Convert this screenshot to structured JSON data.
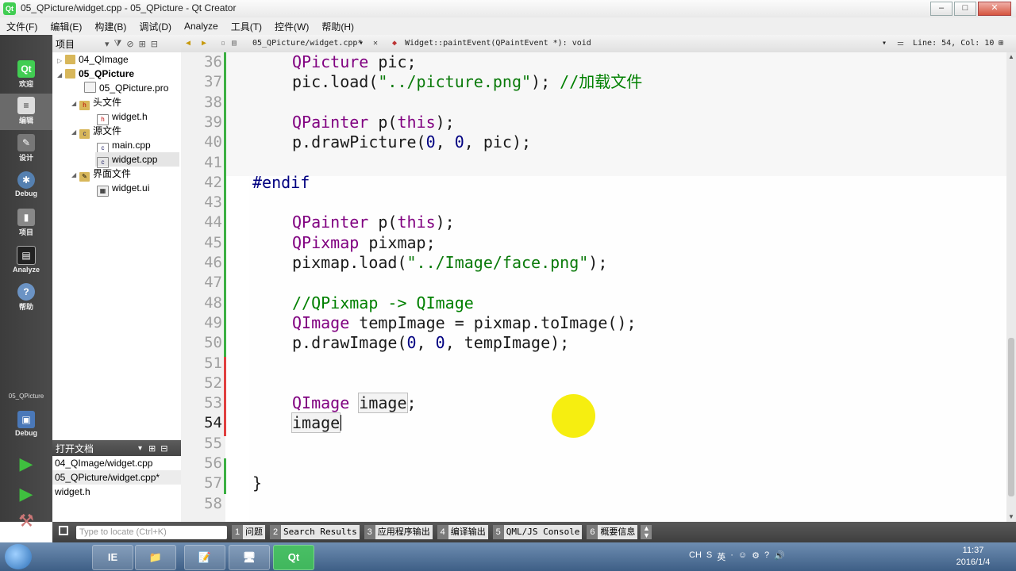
{
  "window": {
    "title": "05_QPicture/widget.cpp - 05_QPicture - Qt Creator",
    "app_icon": "Qt",
    "buttons": [
      "–",
      "□",
      "✕"
    ]
  },
  "menu": [
    "文件(F)",
    "编辑(E)",
    "构建(B)",
    "调试(D)",
    "Analyze",
    "工具(T)",
    "控件(W)",
    "帮助(H)"
  ],
  "modes": [
    {
      "label": "欢迎",
      "icon": "qt-logo-icon"
    },
    {
      "label": "编辑",
      "icon": "edit-document-icon"
    },
    {
      "label": "设计",
      "icon": "design-pen-icon"
    },
    {
      "label": "Debug",
      "icon": "debug-bug-icon"
    },
    {
      "label": "项目",
      "icon": "project-wrench-icon"
    },
    {
      "label": "Analyze",
      "icon": "analyze-icon"
    },
    {
      "label": "帮助",
      "icon": "help-icon"
    }
  ],
  "mode_project": "05_QPicture",
  "mode_debug": "Debug",
  "project_panel": {
    "title": "项目",
    "tree": [
      {
        "label": "04_QImage",
        "indent": 0,
        "arrow": "▷",
        "icon": "folder-icon",
        "bold": false
      },
      {
        "label": "05_QPicture",
        "indent": 0,
        "arrow": "◢",
        "icon": "folder-icon",
        "bold": true
      },
      {
        "label": "05_QPicture.pro",
        "indent": 1,
        "arrow": "",
        "icon": "pro-file-icon",
        "bold": false
      },
      {
        "label": "头文件",
        "indent": 1,
        "arrow": "◢",
        "icon": "header-folder-icon",
        "bold": false
      },
      {
        "label": "widget.h",
        "indent": 2,
        "arrow": "",
        "icon": "h-file-icon",
        "bold": false
      },
      {
        "label": "源文件",
        "indent": 1,
        "arrow": "◢",
        "icon": "source-folder-icon",
        "bold": false
      },
      {
        "label": "main.cpp",
        "indent": 2,
        "arrow": "",
        "icon": "cpp-file-icon",
        "bold": false
      },
      {
        "label": "widget.cpp",
        "indent": 2,
        "arrow": "",
        "icon": "cpp-file-icon",
        "bold": false,
        "selected": true
      },
      {
        "label": "界面文件",
        "indent": 1,
        "arrow": "◢",
        "icon": "forms-folder-icon",
        "bold": false
      },
      {
        "label": "widget.ui",
        "indent": 2,
        "arrow": "",
        "icon": "ui-file-icon",
        "bold": false
      }
    ]
  },
  "open_docs": {
    "title": "打开文档",
    "items": [
      "04_QImage/widget.cpp",
      "05_QPicture/widget.cpp*",
      "widget.h"
    ]
  },
  "editor_toolbar": {
    "file": "05_QPicture/widget.cpp*",
    "function": "Widget::paintEvent(QPaintEvent *): void",
    "position": "Line: 54, Col: 10"
  },
  "code": [
    {
      "n": "36",
      "html_parts": [
        {
          "c": "t",
          "v": "QPicture"
        },
        {
          "c": "",
          "v": " pic;"
        }
      ]
    },
    {
      "n": "37",
      "html_parts": [
        {
          "c": "",
          "v": "pic.load("
        },
        {
          "c": "s",
          "v": "\"../picture.png\""
        },
        {
          "c": "",
          "v": "); "
        },
        {
          "c": "c",
          "v": "//加载文件"
        }
      ]
    },
    {
      "n": "38",
      "html_parts": []
    },
    {
      "n": "39",
      "html_parts": [
        {
          "c": "t",
          "v": "QPainter"
        },
        {
          "c": "",
          "v": " p("
        },
        {
          "c": "k",
          "v": "this"
        },
        {
          "c": "",
          "v": ");"
        }
      ]
    },
    {
      "n": "40",
      "html_parts": [
        {
          "c": "",
          "v": "p.drawPicture("
        },
        {
          "c": "n",
          "v": "0"
        },
        {
          "c": "",
          "v": ", "
        },
        {
          "c": "n",
          "v": "0"
        },
        {
          "c": "",
          "v": ", pic);"
        }
      ]
    },
    {
      "n": "41",
      "html_parts": []
    },
    {
      "n": "42",
      "html_parts": [
        {
          "c": "pp",
          "v": "#endif"
        }
      ],
      "outdent": true
    },
    {
      "n": "43",
      "html_parts": []
    },
    {
      "n": "44",
      "html_parts": [
        {
          "c": "t",
          "v": "QPainter"
        },
        {
          "c": "",
          "v": " p("
        },
        {
          "c": "k",
          "v": "this"
        },
        {
          "c": "",
          "v": ");"
        }
      ]
    },
    {
      "n": "45",
      "html_parts": [
        {
          "c": "t",
          "v": "QPixmap"
        },
        {
          "c": "",
          "v": " pixmap;"
        }
      ]
    },
    {
      "n": "46",
      "html_parts": [
        {
          "c": "",
          "v": "pixmap.load("
        },
        {
          "c": "s",
          "v": "\"../Image/face.png\""
        },
        {
          "c": "",
          "v": ");"
        }
      ]
    },
    {
      "n": "47",
      "html_parts": []
    },
    {
      "n": "48",
      "html_parts": [
        {
          "c": "c",
          "v": "//QPixmap -> QImage"
        }
      ]
    },
    {
      "n": "49",
      "html_parts": [
        {
          "c": "t",
          "v": "QImage"
        },
        {
          "c": "",
          "v": " tempImage = pixmap.toImage();"
        }
      ]
    },
    {
      "n": "50",
      "html_parts": [
        {
          "c": "",
          "v": "p.drawImage("
        },
        {
          "c": "n",
          "v": "0"
        },
        {
          "c": "",
          "v": ", "
        },
        {
          "c": "n",
          "v": "0"
        },
        {
          "c": "",
          "v": ", tempImage);"
        }
      ]
    },
    {
      "n": "51",
      "html_parts": []
    },
    {
      "n": "52",
      "html_parts": []
    },
    {
      "n": "53",
      "html_parts": [
        {
          "c": "t",
          "v": "QImage"
        },
        {
          "c": "",
          "v": " "
        },
        {
          "c": "boxed",
          "v": "image"
        },
        {
          "c": "",
          "v": ";"
        }
      ]
    },
    {
      "n": "54",
      "html_parts": [
        {
          "c": "boxed",
          "v": "image"
        }
      ],
      "current": true,
      "cursor": true
    },
    {
      "n": "55",
      "html_parts": []
    },
    {
      "n": "56",
      "html_parts": []
    },
    {
      "n": "57",
      "html_parts": [
        {
          "c": "",
          "v": "}"
        }
      ],
      "outdent": true
    },
    {
      "n": "58",
      "html_parts": []
    }
  ],
  "locator": {
    "placeholder": "Type to locate (Ctrl+K)"
  },
  "output_tabs": [
    {
      "num": "1",
      "label": "问题"
    },
    {
      "num": "2",
      "label": "Search Results"
    },
    {
      "num": "3",
      "label": "应用程序输出"
    },
    {
      "num": "4",
      "label": "编译输出"
    },
    {
      "num": "5",
      "label": "QML/JS Console"
    },
    {
      "num": "6",
      "label": "概要信息"
    }
  ],
  "taskbar": {
    "apps": [
      "IE",
      "📁",
      "📝",
      "🖥",
      "Qt"
    ],
    "tray": [
      "CH",
      "S",
      "英",
      "·",
      "☺",
      "⚙",
      "?",
      "🔊"
    ],
    "time": "11:37",
    "date": "2016/1/4"
  },
  "colors": {
    "accent": "#41cd52",
    "sidebar": "#404040",
    "keyword": "#800080",
    "string": "#0a7a0a"
  }
}
